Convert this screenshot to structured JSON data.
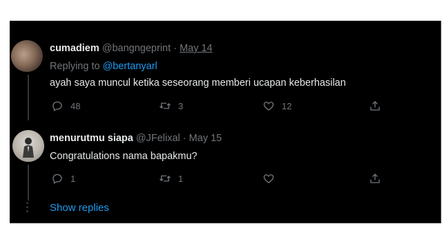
{
  "tweets": [
    {
      "name": "cumadiem",
      "handle": "@bangngeprint",
      "sep": "·",
      "date": "May 14",
      "replying_prefix": "Replying to ",
      "replying_to": "@bertanyarl",
      "text": "ayah saya muncul ketika seseorang memberi ucapan keberhasilan",
      "replies": "48",
      "retweets": "3",
      "likes": "12"
    },
    {
      "name": "menurutmu siapa",
      "handle": "@JFelixal",
      "sep": "·",
      "date": "May 15",
      "text": "Congratulations nama bapakmu?",
      "replies": "1",
      "retweets": "1",
      "likes": ""
    }
  ],
  "show_replies": "Show replies",
  "icons": [
    "reply-icon",
    "retweet-icon",
    "like-icon",
    "share-icon"
  ],
  "colors": {
    "background": "#000000",
    "text": "#e7e9ea",
    "muted": "#71767b",
    "link": "#1d9bf0"
  }
}
